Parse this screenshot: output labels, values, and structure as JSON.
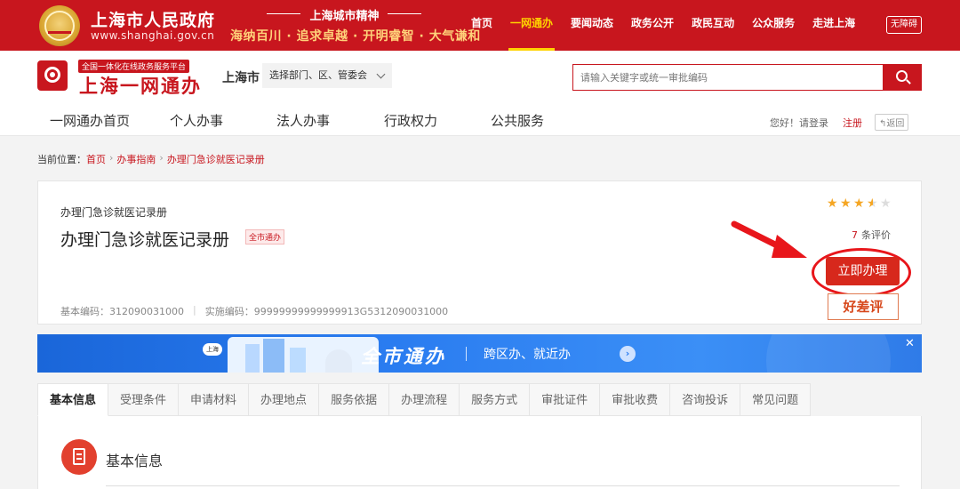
{
  "topbar": {
    "gov_name": "上海市人民政府",
    "gov_url": "www.shanghai.gov.cn",
    "spirit_title": "上海城市精神",
    "spirit_text": "海纳百川 · 追求卓越 · 开明睿智 · 大气谦和",
    "nav": [
      "首页",
      "一网通办",
      "要闻动态",
      "政务公开",
      "政民互动",
      "公众服务",
      "走进上海"
    ],
    "active_nav": "一网通办",
    "barrier_free": "无障碍"
  },
  "header": {
    "badge": "全国一体化在线政务服务平台",
    "brand": "上海一网通办",
    "city": "上海市",
    "dept_select": "选择部门、区、管委会",
    "search_placeholder": "请输入关键字或统一审批编码",
    "nav": [
      "一网通办首页",
      "个人办事",
      "法人办事",
      "行政权力",
      "公共服务"
    ],
    "login_prompt": "您好！请登录",
    "register": "注册",
    "back": "返回"
  },
  "breadcrumb": {
    "label": "当前位置：",
    "items": [
      "首页",
      "办事指南",
      "办理门急诊就医记录册"
    ]
  },
  "service": {
    "subtitle": "办理门急诊就医记录册",
    "title": "办理门急诊就医记录册",
    "tag": "全市通办",
    "base_code_label": "基本编码：312090031000",
    "impl_code_label": "实施编码：99999999999999913G5312090031000",
    "rating": 3.5,
    "rating_max": 5,
    "review_count": "7",
    "review_suffix": "条评价",
    "apply_button": "立即办理",
    "rate_button": "好差评",
    "highlight_color": "#e8161b"
  },
  "banner": {
    "pin": "上海",
    "title": "全市通办",
    "subtitle": "跨区办、就近办"
  },
  "tabs": [
    "基本信息",
    "受理条件",
    "申请材料",
    "办理地点",
    "服务依据",
    "办理流程",
    "服务方式",
    "审批证件",
    "审批收费",
    "咨询投诉",
    "常见问题"
  ],
  "active_tab": "基本信息",
  "section": {
    "title": "基本信息"
  },
  "colors": {
    "brand_red": "#c8161e",
    "accent_gold": "#ffd200",
    "banner_blue": "#2a7cf0"
  }
}
